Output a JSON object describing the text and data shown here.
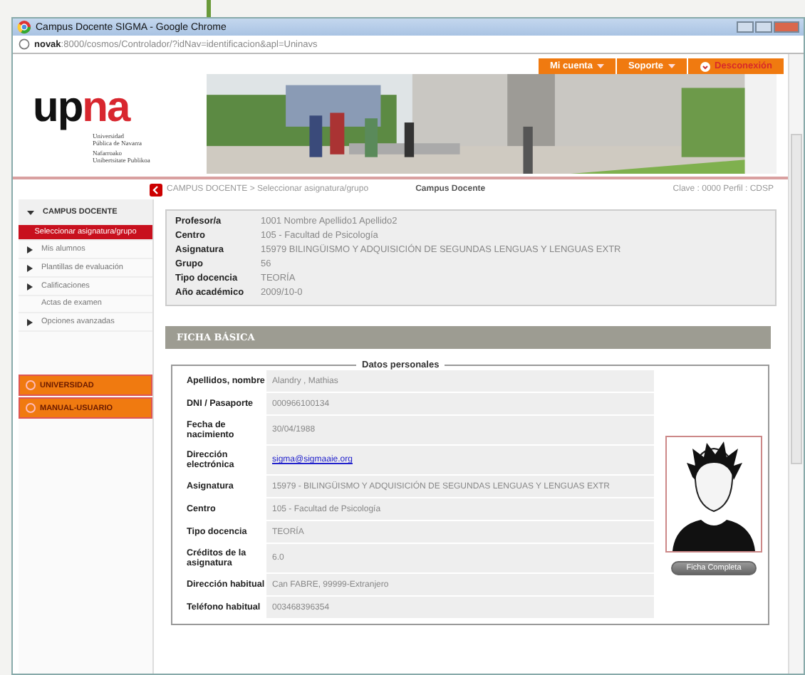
{
  "browser": {
    "title": "Campus Docente SIGMA - Google Chrome",
    "url_host": "novak",
    "url_rest": ":8000/cosmos/Controlador/?idNav=identificacion&apl=Uninavs"
  },
  "logo": {
    "mark_a": "up",
    "mark_b": "na",
    "line_1": "Universidad",
    "line_2": "Pública de Navarra",
    "line_3": "Nafarroako",
    "line_4": "Unibertsitate Publikoa"
  },
  "top_menu": [
    {
      "label": "Mi cuenta",
      "kind": "dropdown"
    },
    {
      "label": "Soporte",
      "kind": "dropdown"
    },
    {
      "label": "Desconexión",
      "kind": "logout"
    }
  ],
  "breadcrumb": "CAMPUS DOCENTE > Seleccionar asignatura/grupo",
  "page_title": "Campus Docente",
  "session": "Clave : 0000  Perfil : CDSP",
  "sidebar": {
    "section": {
      "label": "CAMPUS DOCENTE",
      "expanded": true
    },
    "items": [
      {
        "label": "Seleccionar asignatura/grupo",
        "selected": true,
        "kind": "plain"
      },
      {
        "label": "Mis alumnos",
        "selected": false,
        "kind": "bullet"
      },
      {
        "label": "Plantillas de evaluación",
        "selected": false,
        "kind": "bullet"
      },
      {
        "label": "Calificaciones",
        "selected": false,
        "kind": "bullet"
      },
      {
        "label": "Actas de examen",
        "selected": false,
        "kind": "plain"
      },
      {
        "label": "Opciones avanzadas",
        "selected": false,
        "kind": "bullet"
      }
    ],
    "buttons": [
      "UNIVERSIDAD",
      "MANUAL-USUARIO"
    ]
  },
  "info": [
    {
      "label": "Profesor/a",
      "value": "1001 Nombre Apellido1 Apellido2"
    },
    {
      "label": "Centro",
      "value": "105 -  Facultad de Psicología"
    },
    {
      "label": "Asignatura",
      "value": "15979  BILINGÜISMO Y ADQUISICIÓN DE SEGUNDAS LENGUAS Y LENGUAS EXTR"
    },
    {
      "label": "Grupo",
      "value": "56"
    },
    {
      "label": "Tipo docencia",
      "value": "TEORÍA"
    },
    {
      "label": "Año académico",
      "value": "2009/10-0"
    }
  ],
  "section_title": "FICHA BÁSICA",
  "personal": {
    "legend": "Datos personales",
    "rows": [
      {
        "label": "Apellidos, nombre",
        "value": "Alandry , Mathias",
        "kind": "text"
      },
      {
        "label": "DNI / Pasaporte",
        "value": "000966100134",
        "kind": "text"
      },
      {
        "label": "Fecha de nacimiento",
        "value": "30/04/1988",
        "kind": "text"
      },
      {
        "label": "Dirección electrónica",
        "value": "sigma@sigmaaie.org",
        "kind": "link"
      },
      {
        "label": "Asignatura",
        "value": "15979 -  BILINGÜISMO Y ADQUISICIÓN DE SEGUNDAS LENGUAS Y LENGUAS EXTR",
        "kind": "text"
      },
      {
        "label": "Centro",
        "value": "105 -  Facultad de Psicología",
        "kind": "text"
      },
      {
        "label": "Tipo docencia",
        "value": "TEORÍA",
        "kind": "text"
      },
      {
        "label": "Créditos de la asignatura",
        "value": "6.0",
        "kind": "text"
      },
      {
        "label": "Dirección habitual",
        "value": "Can FABRE, 99999-Extranjero",
        "kind": "text"
      },
      {
        "label": "Teléfono habitual",
        "value": "003468396354",
        "kind": "text"
      }
    ],
    "button": "Ficha Completa"
  }
}
